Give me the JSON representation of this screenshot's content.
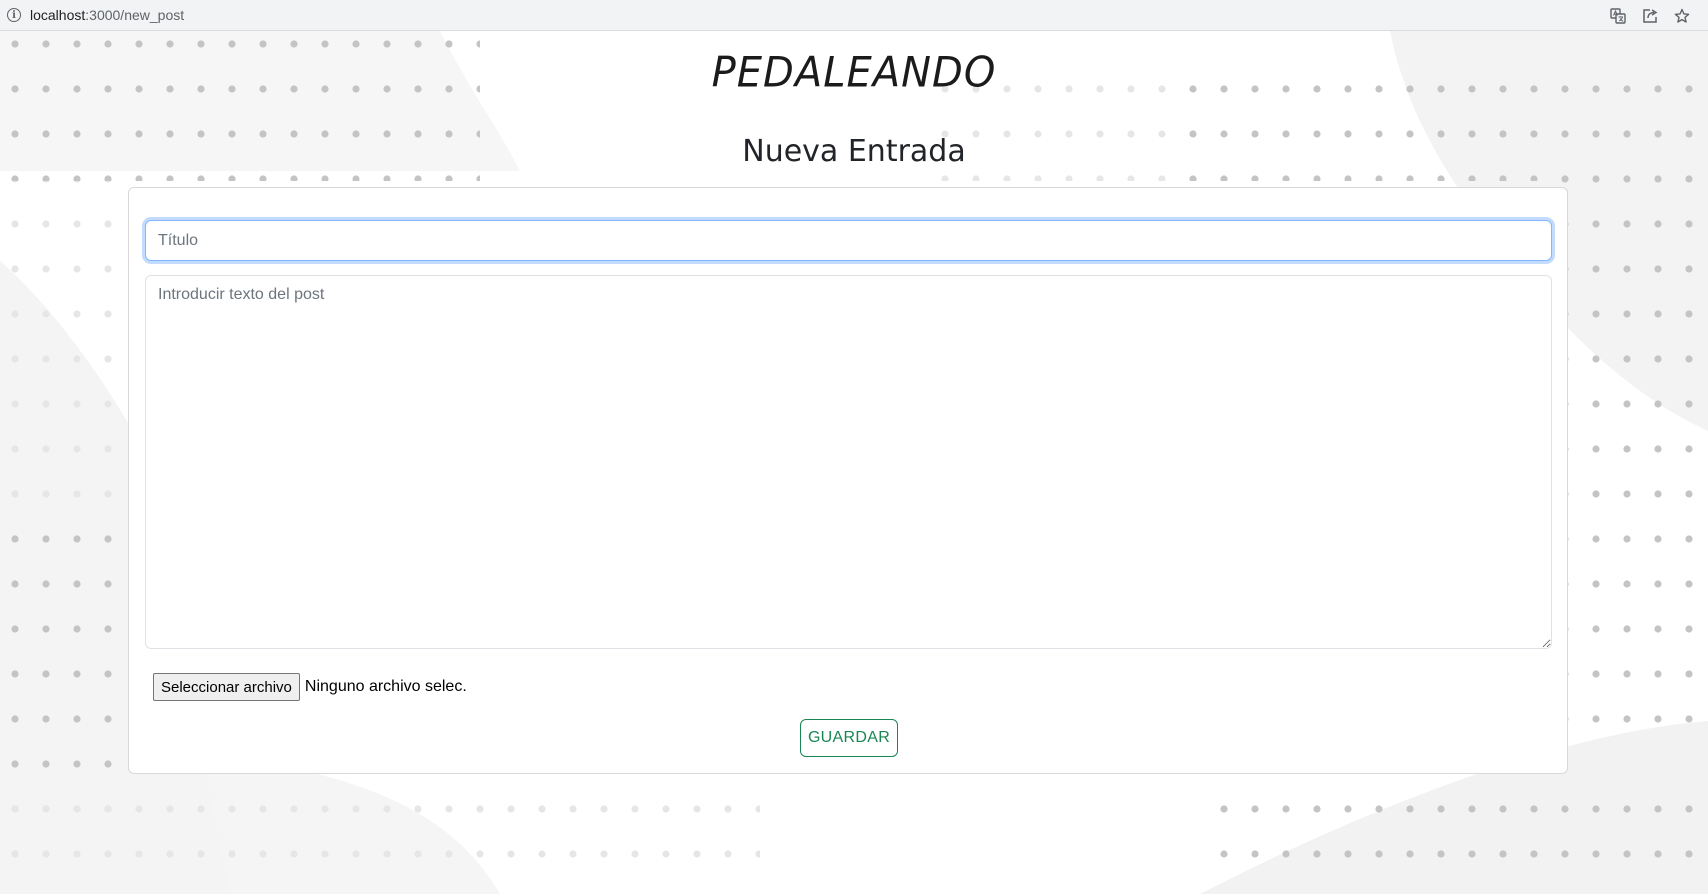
{
  "browser": {
    "url_host": "localhost",
    "url_path": ":3000/new_post"
  },
  "header": {
    "brand": "PEDALEANDO",
    "page_title": "Nueva Entrada"
  },
  "form": {
    "title_placeholder": "Título",
    "title_value": "",
    "body_placeholder": "Introducir texto del post",
    "body_value": "",
    "file_button_label": "Seleccionar archivo",
    "file_status": "Ninguno archivo selec.",
    "save_label": "GUARDAR"
  },
  "colors": {
    "accent_green": "#198754",
    "focus_blue": "#86b7fe",
    "dot_gray": "#c8c8c8"
  },
  "icons": [
    "site-info-icon",
    "translate-icon",
    "share-icon",
    "star-icon"
  ]
}
